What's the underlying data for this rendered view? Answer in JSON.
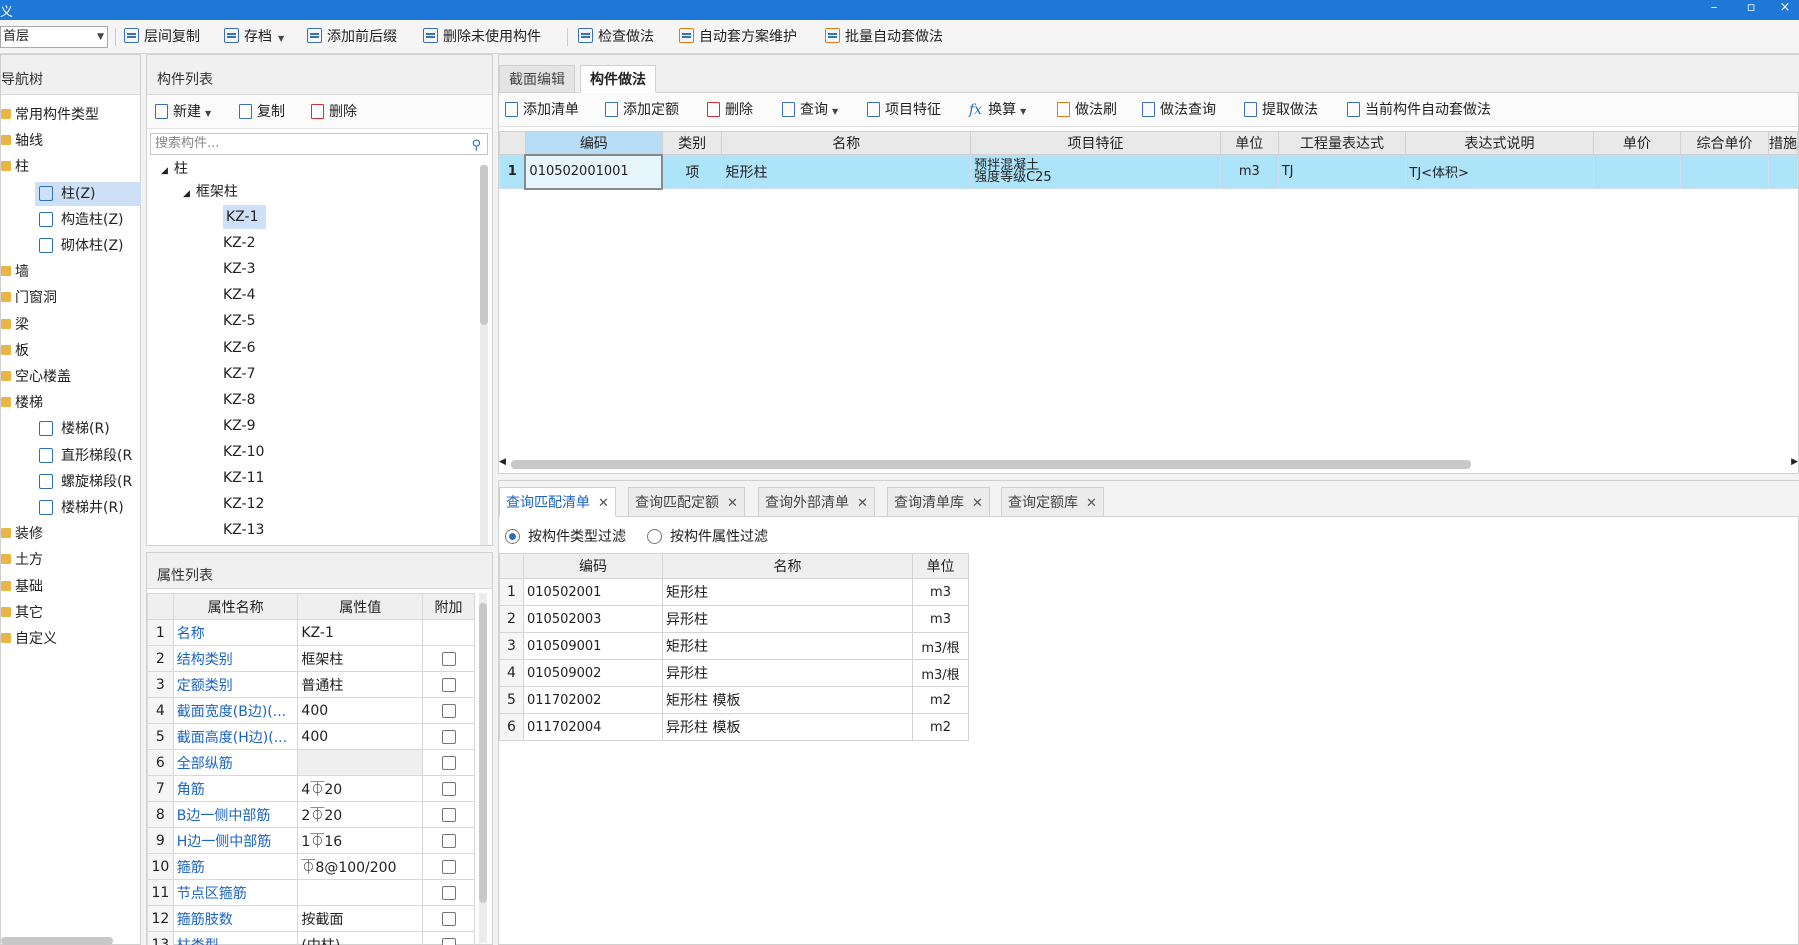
{
  "window": {
    "title": "义",
    "minimize": "–",
    "maximize": "▫",
    "close": "×"
  },
  "toolbar": {
    "floor_select": "首层",
    "buttons": [
      "层间复制",
      "存档",
      "添加前后缀",
      "删除未使用构件",
      "检查做法",
      "自动套方案维护",
      "批量自动套做法"
    ]
  },
  "nav": {
    "title": "导航树",
    "items": [
      {
        "label": "常用构件类型",
        "level": 0
      },
      {
        "label": "轴线",
        "level": 0
      },
      {
        "label": "柱",
        "level": 0
      },
      {
        "label": "柱(Z)",
        "level": 1,
        "selected": true
      },
      {
        "label": "构造柱(Z)",
        "level": 1
      },
      {
        "label": "砌体柱(Z)",
        "level": 1
      },
      {
        "label": "墙",
        "level": 0
      },
      {
        "label": "门窗洞",
        "level": 0
      },
      {
        "label": "梁",
        "level": 0
      },
      {
        "label": "板",
        "level": 0
      },
      {
        "label": "空心楼盖",
        "level": 0
      },
      {
        "label": "楼梯",
        "level": 0
      },
      {
        "label": "楼梯(R)",
        "level": 1
      },
      {
        "label": "直形梯段(R",
        "level": 1
      },
      {
        "label": "螺旋梯段(R",
        "level": 1
      },
      {
        "label": "楼梯井(R)",
        "level": 1
      },
      {
        "label": "装修",
        "level": 0
      },
      {
        "label": "土方",
        "level": 0
      },
      {
        "label": "基础",
        "level": 0
      },
      {
        "label": "其它",
        "level": 0
      },
      {
        "label": "自定义",
        "level": 0
      }
    ]
  },
  "component_list": {
    "title": "构件列表",
    "new_label": "新建",
    "copy_label": "复制",
    "delete_label": "删除",
    "search_placeholder": "搜索构件...",
    "tree_root": "柱",
    "tree_group": "框架柱",
    "items": [
      "KZ-1",
      "KZ-2",
      "KZ-3",
      "KZ-4",
      "KZ-5",
      "KZ-6",
      "KZ-7",
      "KZ-8",
      "KZ-9",
      "KZ-10",
      "KZ-11",
      "KZ-12",
      "KZ-13"
    ],
    "selected": "KZ-1"
  },
  "property_list": {
    "title": "属性列表",
    "headers": [
      "属性名称",
      "属性值",
      "附加"
    ],
    "rows": [
      {
        "num": "1",
        "name": "名称",
        "value": "KZ-1",
        "checkbox": false
      },
      {
        "num": "2",
        "name": "结构类别",
        "value": "框架柱",
        "checkbox": true
      },
      {
        "num": "3",
        "name": "定额类别",
        "value": "普通柱",
        "checkbox": true
      },
      {
        "num": "4",
        "name": "截面宽度(B边)(...",
        "value": "400",
        "checkbox": true
      },
      {
        "num": "5",
        "name": "截面高度(H边)(...",
        "value": "400",
        "checkbox": true
      },
      {
        "num": "6",
        "name": "全部纵筋",
        "value": "",
        "checkbox": true,
        "grey": true
      },
      {
        "num": "7",
        "name": "角筋",
        "value": "4⏁20",
        "checkbox": true
      },
      {
        "num": "8",
        "name": "B边一侧中部筋",
        "value": "2⏁20",
        "checkbox": true
      },
      {
        "num": "9",
        "name": "H边一侧中部筋",
        "value": "1⏁16",
        "checkbox": true
      },
      {
        "num": "10",
        "name": "箍筋",
        "value": "⏁8@100/200",
        "checkbox": true
      },
      {
        "num": "11",
        "name": "节点区箍筋",
        "value": "",
        "checkbox": true
      },
      {
        "num": "12",
        "name": "箍筋肢数",
        "value": "按截面",
        "checkbox": true
      },
      {
        "num": "13",
        "name": "柱类型",
        "value": "(中柱)",
        "checkbox": true
      }
    ]
  },
  "method_panel": {
    "tabs": [
      "截面编辑",
      "构件做法"
    ],
    "active_tab": "构件做法",
    "toolbar": [
      "添加清单",
      "添加定额",
      "删除",
      "查询",
      "项目特征",
      "换算",
      "做法刷",
      "做法查询",
      "提取做法",
      "当前构件自动套做法"
    ],
    "headers": [
      "编码",
      "类别",
      "名称",
      "项目特征",
      "单位",
      "工程量表达式",
      "表达式说明",
      "单价",
      "综合单价",
      "措施"
    ],
    "rows": [
      {
        "num": "1",
        "code": "010502001001",
        "type": "项",
        "name": "矩形柱",
        "feature_line1": "预拌混凝土",
        "feature_line2": "强度等级C25",
        "unit": "m3",
        "expr": "TJ",
        "expr_desc": "TJ<体积>",
        "price": "",
        "total_price": ""
      }
    ]
  },
  "query_panel": {
    "tabs": [
      "查询匹配清单",
      "查询匹配定额",
      "查询外部清单",
      "查询清单库",
      "查询定额库"
    ],
    "active_tab": "查询匹配清单",
    "filter_by_type": "按构件类型过滤",
    "filter_by_attr": "按构件属性过滤",
    "headers": [
      "编码",
      "名称",
      "单位"
    ],
    "rows": [
      {
        "num": "1",
        "code": "010502001",
        "name": "矩形柱",
        "unit": "m3"
      },
      {
        "num": "2",
        "code": "010502003",
        "name": "异形柱",
        "unit": "m3"
      },
      {
        "num": "3",
        "code": "010509001",
        "name": "矩形柱",
        "unit": "m3/根"
      },
      {
        "num": "4",
        "code": "010509002",
        "name": "异形柱",
        "unit": "m3/根"
      },
      {
        "num": "5",
        "code": "011702002",
        "name": "矩形柱 模板",
        "unit": "m2"
      },
      {
        "num": "6",
        "code": "011702004",
        "name": "异形柱 模板",
        "unit": "m2"
      }
    ]
  },
  "colors": {
    "title_bar": "#1e78d8",
    "selection": "#aee4f9",
    "link_text": "#1c64c4"
  }
}
